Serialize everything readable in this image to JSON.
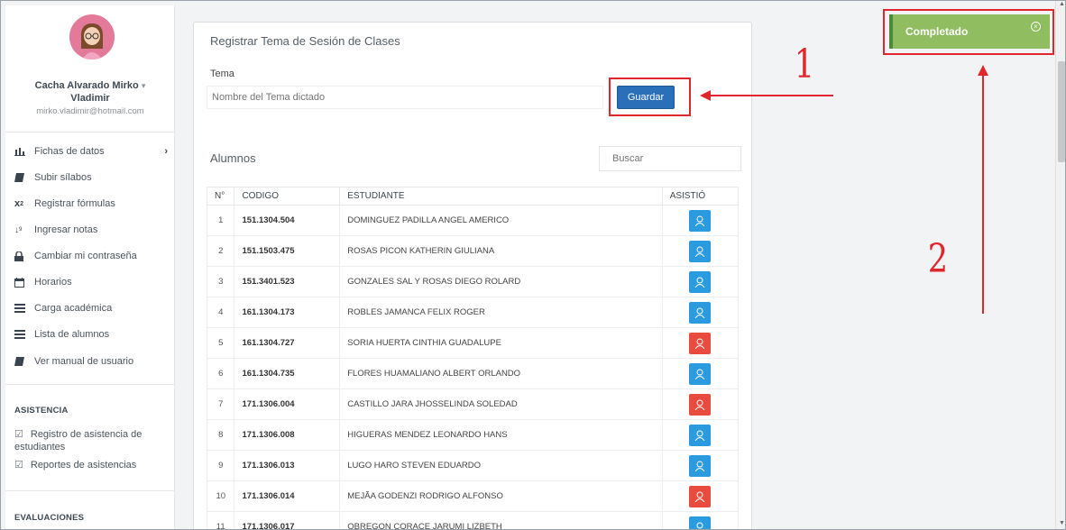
{
  "user": {
    "name_line1": "Cacha Alvarado Mirko",
    "caret": "▾",
    "name_line2": "Vladimir",
    "email": "mirko.vladimir@hotmail.com"
  },
  "menu": [
    {
      "label": "Fichas de datos",
      "icon": "bar-chart-icon",
      "has_arrow": true
    },
    {
      "label": "Subir sílabos",
      "icon": "book-icon"
    },
    {
      "label": "Registrar fórmulas",
      "icon": "subscript-icon"
    },
    {
      "label": "Ingresar notas",
      "icon": "sort-numeric-icon"
    },
    {
      "label": "Cambiar mi contraseña",
      "icon": "lock-icon"
    },
    {
      "label": "Horarios",
      "icon": "calendar-icon"
    },
    {
      "label": "Carga académica",
      "icon": "list-icon"
    },
    {
      "label": "Lista de alumnos",
      "icon": "list-icon"
    },
    {
      "label": "Ver manual de usuario",
      "icon": "book-icon"
    }
  ],
  "asistencia": {
    "title": "ASISTENCIA",
    "items": [
      "Registro de asistencia de estudiantes",
      "Reportes de asistencias"
    ]
  },
  "evaluaciones": {
    "title": "EVALUACIONES"
  },
  "card": {
    "title": "Registrar Tema de Sesión de Clases",
    "tema_label": "Tema",
    "tema_placeholder": "Nombre del Tema dictado",
    "guardar_label": "Guardar",
    "alumnos_title": "Alumnos",
    "buscar_placeholder": "Buscar"
  },
  "table": {
    "headers": [
      "N°",
      "CODIGO",
      "ESTUDIANTE",
      "ASISTIÓ"
    ],
    "rows": [
      {
        "n": "1",
        "code": "151.1304.504",
        "name": "DOMINGUEZ PADILLA ANGEL AMERICO",
        "status": "present"
      },
      {
        "n": "2",
        "code": "151.1503.475",
        "name": "ROSAS PICON KATHERIN GIULIANA",
        "status": "present"
      },
      {
        "n": "3",
        "code": "151.3401.523",
        "name": "GONZALES SAL Y ROSAS DIEGO ROLARD",
        "status": "present"
      },
      {
        "n": "4",
        "code": "161.1304.173",
        "name": "ROBLES JAMANCA FELIX ROGER",
        "status": "present"
      },
      {
        "n": "5",
        "code": "161.1304.727",
        "name": "SORIA HUERTA CINTHIA GUADALUPE",
        "status": "absent"
      },
      {
        "n": "6",
        "code": "161.1304.735",
        "name": "FLORES HUAMALIANO ALBERT ORLANDO",
        "status": "present"
      },
      {
        "n": "7",
        "code": "171.1306.004",
        "name": "CASTILLO JARA JHOSSELINDA SOLEDAD",
        "status": "absent"
      },
      {
        "n": "8",
        "code": "171.1306.008",
        "name": "HIGUERAS MENDEZ LEONARDO HANS",
        "status": "present"
      },
      {
        "n": "9",
        "code": "171.1306.013",
        "name": "LUGO HARO STEVEN EDUARDO",
        "status": "present"
      },
      {
        "n": "10",
        "code": "171.1306.014",
        "name": "MEJÃ­A GODENZI RODRIGO ALFONSO",
        "status": "absent"
      },
      {
        "n": "11",
        "code": "171.1306.017",
        "name": "OBREGON CORACE JARUMI LIZBETH",
        "status": "present"
      }
    ]
  },
  "toast": {
    "title": "Completado",
    "close": "×"
  },
  "annotations": {
    "label_1": "1",
    "label_2": "2"
  },
  "colors": {
    "present": "#2b9be0",
    "absent": "#ea4b3f",
    "highlight": "#e3262b",
    "toast": "#8fbd60",
    "primary": "#2a6fb8"
  }
}
